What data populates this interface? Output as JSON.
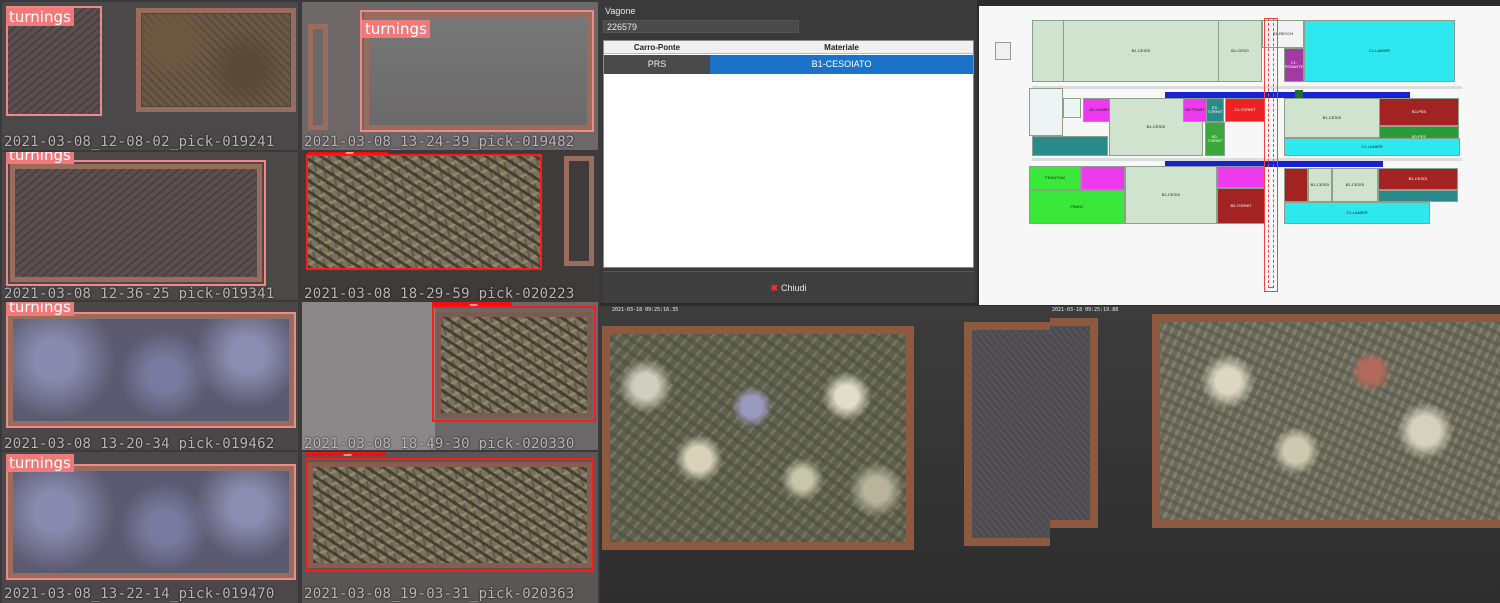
{
  "detections": {
    "cells": [
      {
        "id": "r1c1",
        "label": "turnings",
        "caption": "2021-03-08_12-08-02_pick-019241"
      },
      {
        "id": "r1c2",
        "label": "turnings",
        "caption": "2021-03-08_13-24-39_pick-019482"
      },
      {
        "id": "r2c1",
        "label": "turnings",
        "caption": "2021-03-08_12-36-25_pick-019341"
      },
      {
        "id": "r2c2",
        "label": "train_rails",
        "caption": "2021-03-08_18-29-59_pick-020223"
      },
      {
        "id": "r3c1",
        "label": "turnings",
        "caption": "2021-03-08_13-20-34_pick-019462"
      },
      {
        "id": "r3c2",
        "label": "train_rails",
        "caption": "2021-03-08_18-49-30_pick-020330"
      },
      {
        "id": "r4c1",
        "label": "turnings",
        "caption": "2021-03-08_13-22-14_pick-019470"
      },
      {
        "id": "r4c2",
        "label": "train_rails",
        "caption": "2021-03-08_19-03-31_pick-020363"
      }
    ],
    "colors": {
      "turnings": "#f07a7a",
      "train_rails": "#ee1111"
    }
  },
  "dialog": {
    "field_label": "Vagone",
    "field_value": "226579",
    "columns": [
      "Carro-Ponte",
      "Materiale"
    ],
    "rows": [
      {
        "carro_ponte": "PRS",
        "materiale": "B1-CESOIATO"
      }
    ],
    "close_label": "Chiudi",
    "accent": "#1a73c8"
  },
  "map": {
    "blocks": {
      "b1_cesoi_a": "B1-CESOI",
      "b1_ceso_a": "B1-CESO",
      "b1_recch": "B1-RECCH",
      "c1_lamier": "C1-LAMIER",
      "c1_pesante": "C1-PESANTE",
      "b1_cesoi_b": "B1-CESOI",
      "c1_tornit": "C1-TORNIT",
      "b1_lamier": "B1-LAMIER",
      "b3_frant": "B3-FRANT",
      "e3_tornit": "E3-TORNIT",
      "b1_cesoi_c": "B1-CESOI",
      "b2_tornit": "B2-TORNIT",
      "c1_lamier_b": "C1-LAMIER",
      "b3_pes": "B3-PES",
      "b1_cesoi_d": "B1-CESOI",
      "b3_pes_b": "B3-PES",
      "b1_cesoi_e": "B1-CESOI",
      "b1_cesoi_f": "B1-CESOI",
      "b1_cesoi_g": "B1-CESOI",
      "b3_tornit": "B3-TORNIT",
      "frantum": "FRANTUM",
      "frant_b": "FRANT",
      "c1_lamier_c": "C1-LAMIER"
    }
  },
  "cameras": {
    "timestamps": [
      "2021-03-18 09:25:16.35",
      "2021-03-18 09:25:19.88"
    ]
  }
}
